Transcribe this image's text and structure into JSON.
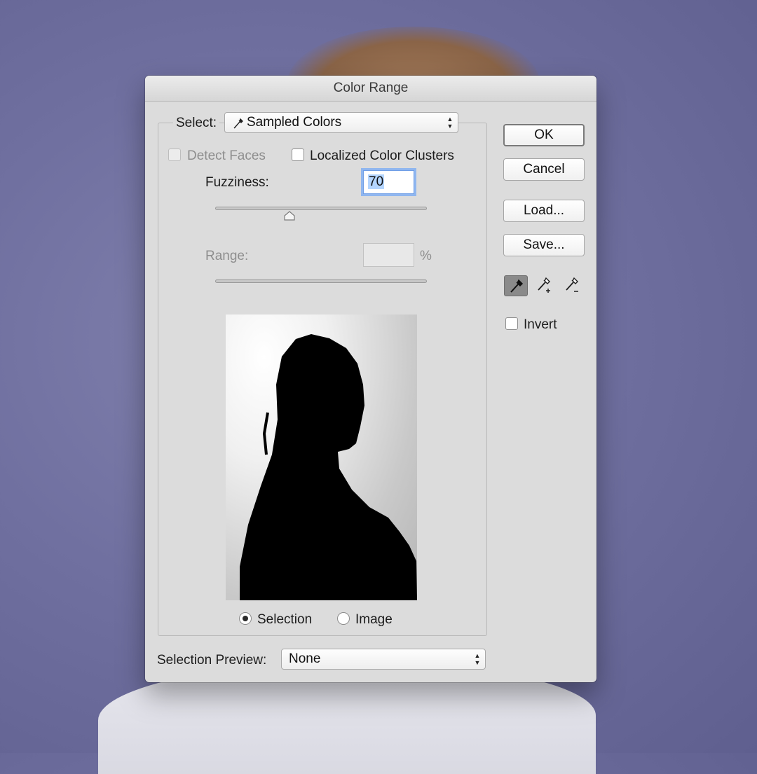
{
  "dialog": {
    "title": "Color Range"
  },
  "select": {
    "label": "Select:",
    "value": "Sampled Colors"
  },
  "options": {
    "detect_faces": {
      "label": "Detect Faces",
      "checked": false,
      "disabled": true
    },
    "localized_clusters": {
      "label": "Localized Color Clusters",
      "checked": false
    }
  },
  "fuzziness": {
    "label": "Fuzziness:",
    "value": "70",
    "slider_fraction": 0.35
  },
  "range": {
    "label": "Range:",
    "value": "",
    "unit": "%"
  },
  "view": {
    "selection": {
      "label": "Selection",
      "selected": true
    },
    "image": {
      "label": "Image",
      "selected": false
    }
  },
  "selection_preview": {
    "label": "Selection Preview:",
    "value": "None"
  },
  "buttons": {
    "ok": "OK",
    "cancel": "Cancel",
    "load": "Load...",
    "save": "Save..."
  },
  "invert": {
    "label": "Invert",
    "checked": false
  },
  "icons": {
    "eyedropper": "eyedropper-icon",
    "eyedropper_add": "eyedropper-plus-icon",
    "eyedropper_subtract": "eyedropper-minus-icon",
    "select_arrows": "updown-arrows-icon"
  }
}
